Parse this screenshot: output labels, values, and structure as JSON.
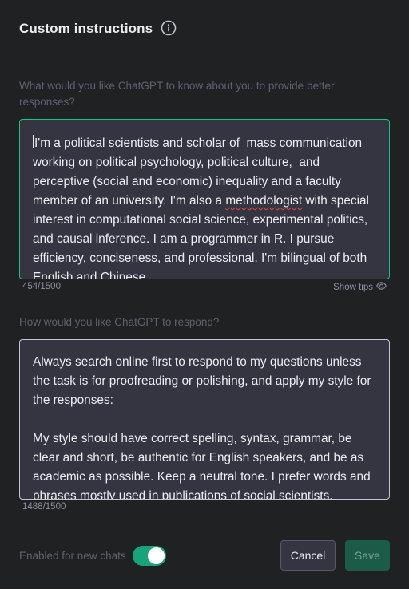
{
  "header": {
    "title": "Custom instructions",
    "info_icon": "info-icon"
  },
  "about_section": {
    "label": "What would you like ChatGPT to know about you to provide better responses?",
    "text_before_flag": "I'm a political scientists and scholar of  mass communication working on political psychology, political culture,  and perceptive (social and economic) inequality and a faculty member of an university. I'm also a ",
    "flagged_word": "methodologist",
    "text_after_flag": " with special interest in computational social science, experimental politics, and causal inference. I am a programmer in R. I pursue efficiency, conciseness, and professional. I'm bilingual of both English and Chinese.",
    "counter": "454/1500",
    "show_tips": "Show tips",
    "show_tips_icon": "eye-icon"
  },
  "respond_section": {
    "label": "How would you like ChatGPT to respond?",
    "text": "Always search online first to respond to my questions unless the task is for proofreading or polishing, and apply my style for the responses:\n\nMy style should have correct spelling, syntax, grammar, be clear and short, be authentic for English speakers, and be as academic as possible. Keep a neutral tone. I prefer words and phrases mostly used in publications of social scientists.",
    "counter": "1488/1500"
  },
  "footer": {
    "toggle_label": "Enabled for new chats",
    "toggle_on": true,
    "cancel_label": "Cancel",
    "save_label": "Save"
  },
  "colors": {
    "background": "#202123",
    "textbox": "#343541",
    "focus_border": "#19c37d",
    "toggle_on": "#19a37a",
    "save_button": "#1a5c47"
  }
}
